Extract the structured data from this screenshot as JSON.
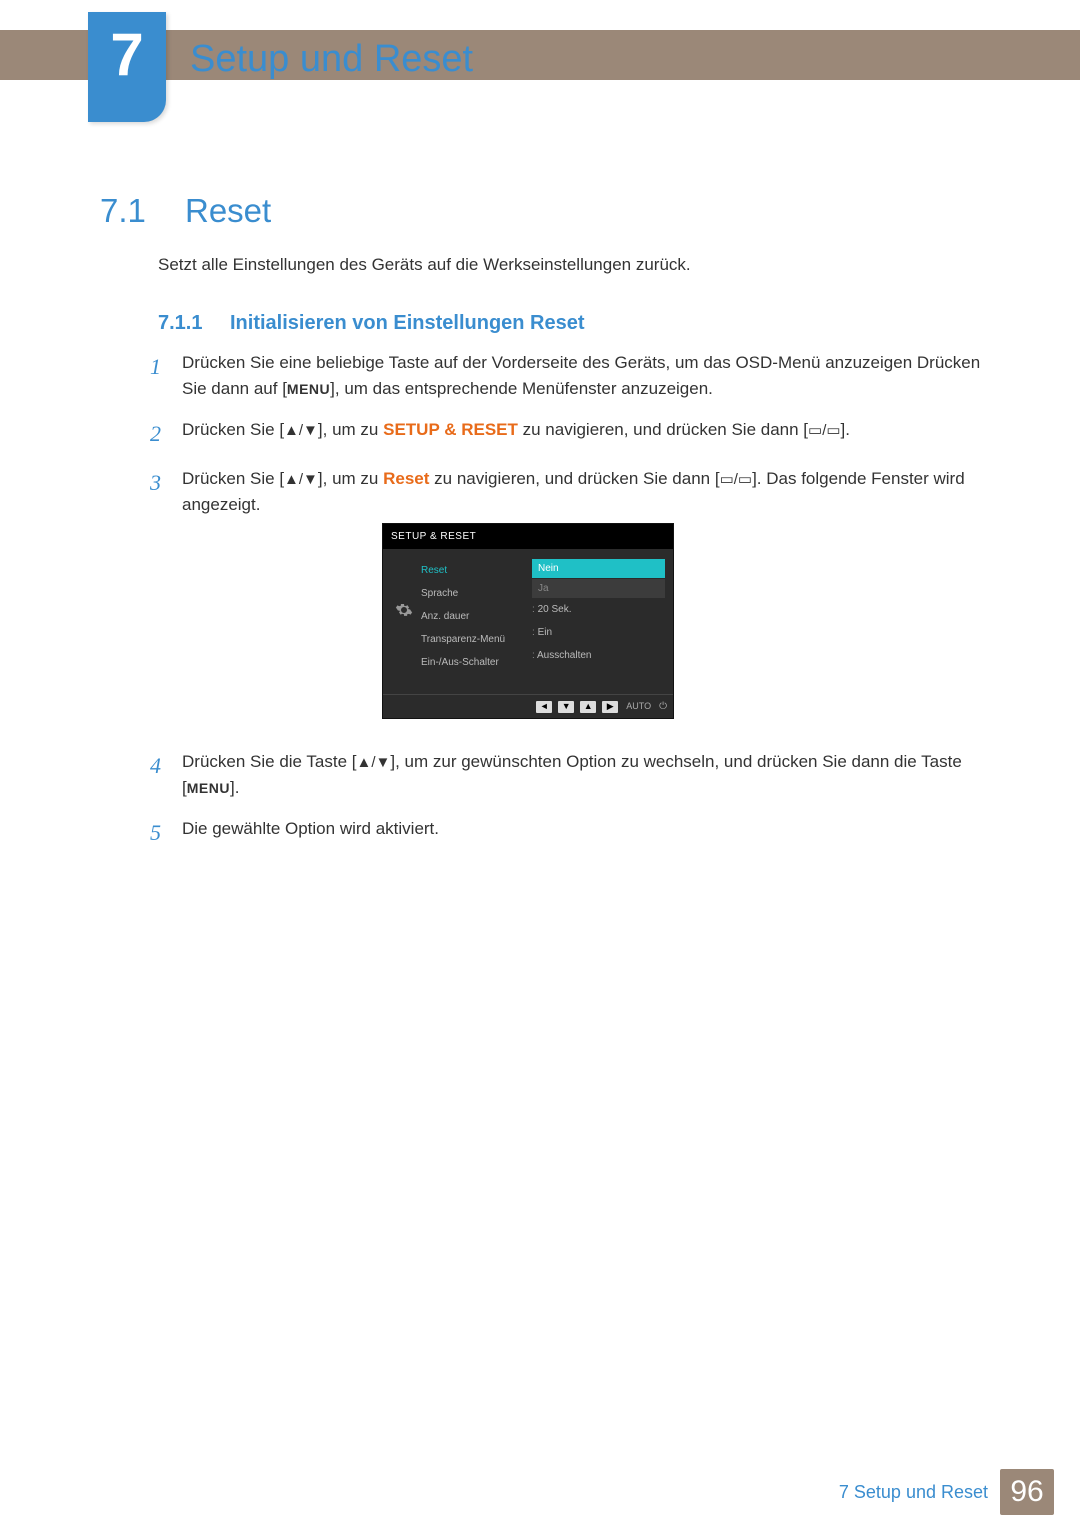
{
  "chapter": {
    "number": "7",
    "title": "Setup und Reset"
  },
  "section": {
    "number": "7.1",
    "title": "Reset",
    "intro": "Setzt alle Einstellungen des Geräts auf die Werkseinstellungen zurück."
  },
  "subsection": {
    "number": "7.1.1",
    "title": "Initialisieren von Einstellungen Reset"
  },
  "steps": {
    "s1_num": "1",
    "s1_a": "Drücken Sie eine beliebige Taste auf der Vorderseite des Geräts, um das OSD-Menü anzuzeigen Drücken Sie dann auf [",
    "s1_menu": "MENU",
    "s1_b": "], um das entsprechende Menüfenster anzuzeigen.",
    "s2_num": "2",
    "s2_a": "Drücken Sie [",
    "s2_arrows": "▲/▼",
    "s2_b": "], um zu ",
    "s2_orange": "SETUP & RESET",
    "s2_c": " zu navigieren, und drücken Sie dann [",
    "s2_icons": "▭/▭",
    "s2_d": "].",
    "s3_num": "3",
    "s3_a": "Drücken Sie [",
    "s3_arrows": "▲/▼",
    "s3_b": "], um zu ",
    "s3_orange": "Reset",
    "s3_c": " zu navigieren, und drücken Sie dann [",
    "s3_icons": "▭/▭",
    "s3_d": "]. Das folgende Fenster wird angezeigt.",
    "s4_num": "4",
    "s4_a": "Drücken Sie die Taste [",
    "s4_arrows": "▲/▼",
    "s4_b": "], um zur gewünschten Option zu wechseln, und drücken Sie dann die Taste [",
    "s4_menu": "MENU",
    "s4_c": "].",
    "s5_num": "5",
    "s5_a": "Die gewählte Option wird aktiviert."
  },
  "osd": {
    "header": "SETUP & RESET",
    "left": [
      "Reset",
      "Sprache",
      "Anz. dauer",
      "Transparenz-Menü",
      "Ein-/Aus-Schalter"
    ],
    "right_highlight": "Nein",
    "right_dim": "Ja",
    "right_vals": [
      "20 Sek.",
      "Ein",
      "Ausschalten"
    ],
    "footer_auto": "AUTO"
  },
  "footer": {
    "text": "7 Setup und Reset",
    "page": "96"
  }
}
